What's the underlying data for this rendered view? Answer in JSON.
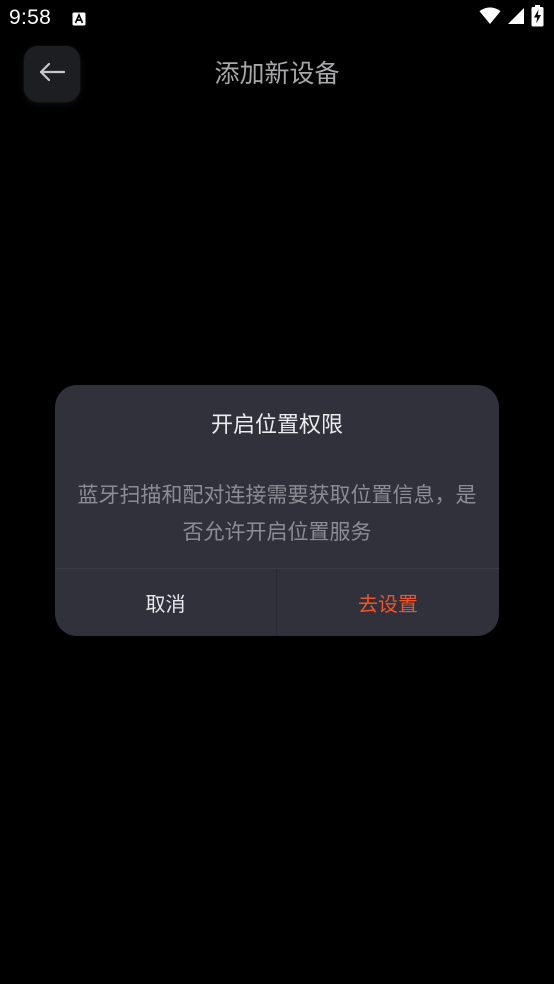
{
  "status_bar": {
    "time": "9:58",
    "notification_icon": "a-letter-icon",
    "icons": [
      "wifi-icon",
      "signal-icon",
      "battery-charging-icon"
    ]
  },
  "header": {
    "title": "添加新设备",
    "back_icon": "arrow-left-icon"
  },
  "dialog": {
    "title": "开启位置权限",
    "message": "蓝牙扫描和配对连接需要获取位置信息，是否允许开启位置服务",
    "cancel_label": "取消",
    "confirm_label": "去设置"
  },
  "colors": {
    "background": "#000000",
    "dialog_background": "#30313b",
    "accent": "#f0552a",
    "title_text": "#a8a8aa",
    "message_text": "#8c8d93"
  }
}
